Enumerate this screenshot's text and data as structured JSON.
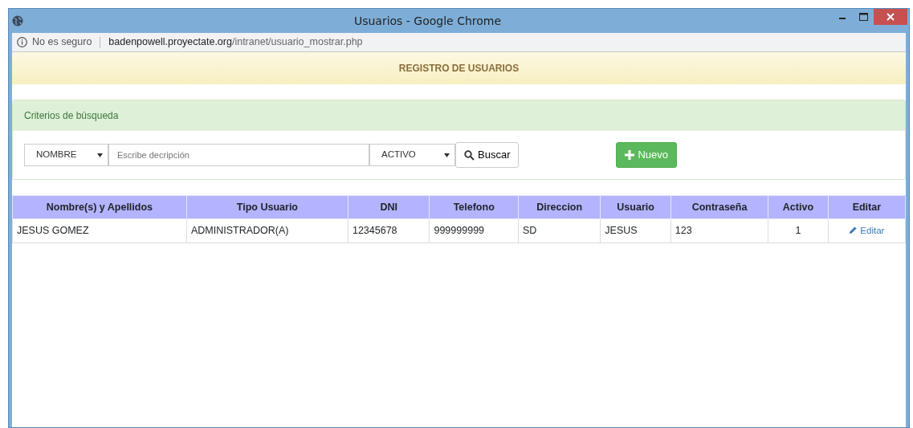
{
  "window": {
    "title": "Usuarios - Google Chrome"
  },
  "address_bar": {
    "security": "No es seguro",
    "domain": "badenpowell.proyectate.org",
    "path": "/intranet/usuario_mostrar.php"
  },
  "header": {
    "title": "REGISTRO DE USUARIOS"
  },
  "search_panel": {
    "title": "Criterios de búsqueda",
    "field_select": "NOMBRE",
    "search": {
      "placeholder": "Escribe decripción"
    },
    "status_select": "ACTIVO",
    "search_button": "Buscar",
    "new_button": "Nuevo"
  },
  "table": {
    "columns": [
      "Nombre(s) y Apellidos",
      "Tipo Usuario",
      "DNI",
      "Telefono",
      "Direccion",
      "Usuario",
      "Contraseña",
      "Activo",
      "Editar"
    ],
    "rows": [
      {
        "cells": [
          "JESUS GOMEZ",
          "ADMINISTRADOR(A)",
          "12345678",
          "999999999",
          "SD",
          "JESUS",
          "123",
          "1"
        ],
        "edit": "Editar"
      }
    ]
  }
}
